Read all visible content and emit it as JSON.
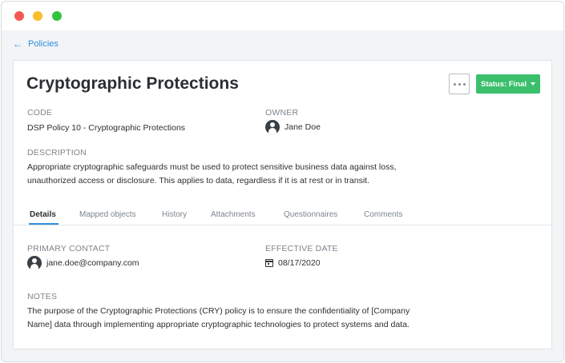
{
  "breadcrumb": {
    "label": "Policies",
    "arrow": "←"
  },
  "policy": {
    "title": "Cryptographic Protections",
    "status_label": "Status: Final",
    "code_label": "CODE",
    "code_value": "DSP Policy 10 - Cryptographic Protections",
    "owner_label": "OWNER",
    "owner_value": "Jane Doe",
    "description_label": "DESCRIPTION",
    "description_line1": "Appropriate cryptographic safeguards must be used to protect sensitive business data against loss,",
    "description_line2": "unauthorized access or disclosure. This applies to data, regardless if it is at rest or in transit."
  },
  "tabs": [
    {
      "label": "Details",
      "active": true
    },
    {
      "label": "Mapped objects"
    },
    {
      "label": "History"
    },
    {
      "label": "Attachments"
    },
    {
      "label": "Questionnaires"
    },
    {
      "label": "Comments"
    }
  ],
  "details": {
    "primary_contact_label": "PRIMARY CONTACT",
    "primary_contact_value": "jane.doe@company.com",
    "effective_date_label": "EFFECTIVE DATE",
    "effective_date_value": "08/17/2020",
    "notes_label": "NOTES",
    "notes_line1": "The purpose of the Cryptographic Protections (CRY) policy is to ensure the confidentiality of [Company",
    "notes_line2": "Name] data through implementing appropriate cryptographic technologies to protect systems and data."
  },
  "colors": {
    "accent": "#2f8fdd",
    "status_green": "#3cbf6c",
    "window_red": "#f45a55",
    "window_yellow": "#fcbc2c",
    "window_green": "#30c43f"
  },
  "icons": [
    "close-icon",
    "minimize-icon",
    "maximize-icon",
    "arrow-left-icon",
    "more-icon",
    "caret-down-icon",
    "user-icon",
    "calendar-icon"
  ]
}
